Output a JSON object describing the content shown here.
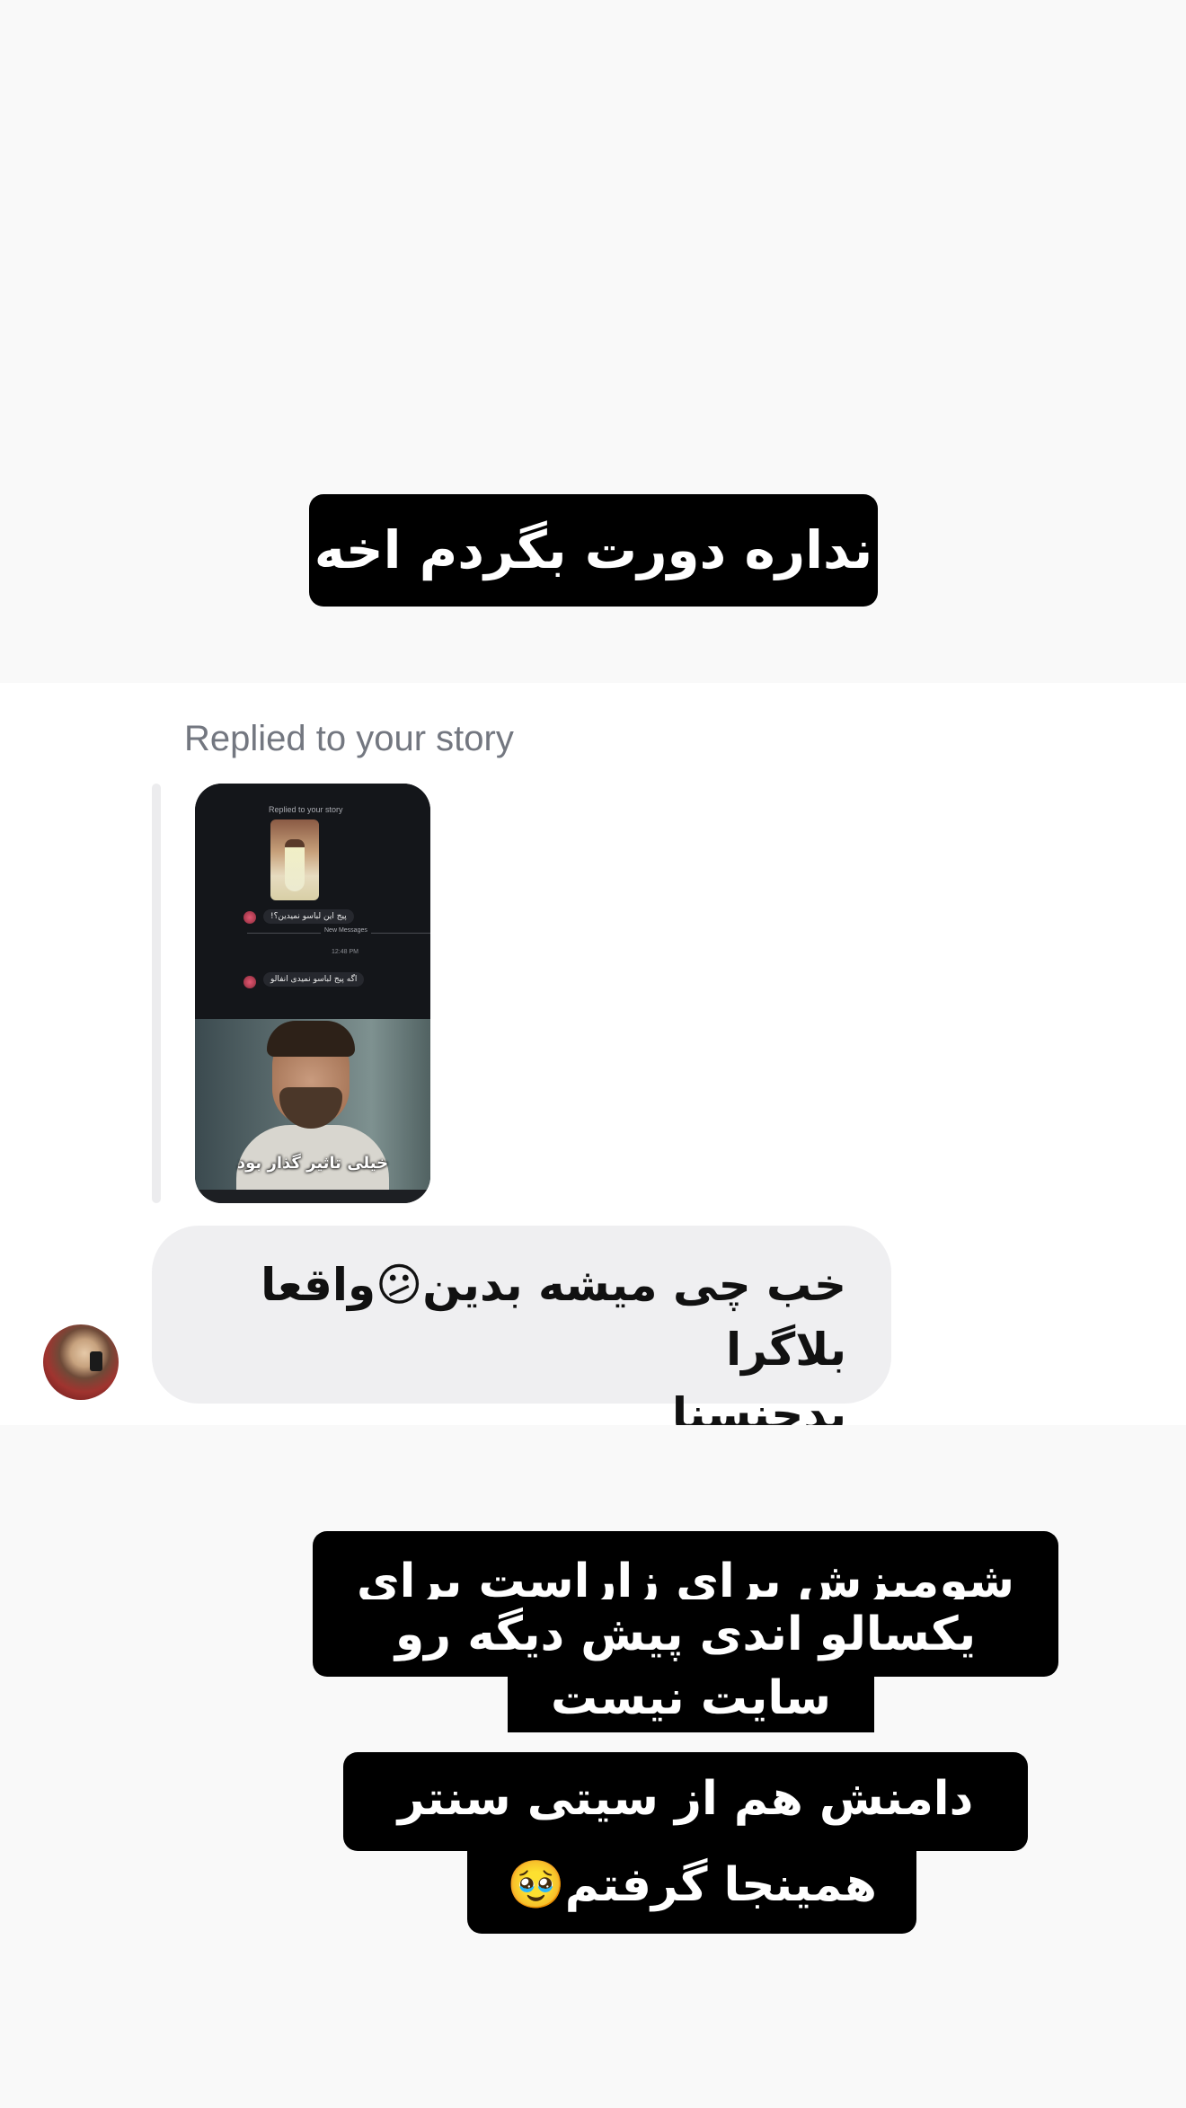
{
  "top_caption": {
    "text": "نداره دورت بگردم اخه"
  },
  "reply": {
    "label": "Replied to your story",
    "story_preview": {
      "header": "Replied to your story",
      "message_1": "پیج این لباسو نمیدین؟!",
      "divider_label": "New Messages",
      "time": "12:48 PM",
      "message_2": "اگه پیج لباسو نمیدی انفالو",
      "subtitle": "خیلی تاثیر گذار بود"
    }
  },
  "message": {
    "line_1": "خب چی میشه بدین😕واقعا بلاگرا",
    "line_2": "بدجنسنا"
  },
  "sender": {
    "avatar": "avatar"
  },
  "bottom_caption": {
    "lines": [
      "شومیزش برای زاراست برای",
      "یکسالو اندی پیش دیگه رو",
      "سایت نیست",
      "دامنش هم از سیتی سنتر",
      "همینجا گرفتم🥹"
    ]
  },
  "colors": {
    "page_background": "#f9f9f9",
    "chat_background": "#ffffff",
    "bubble_background": "#efeff1",
    "caption_background": "#000000",
    "label_gray": "#737780"
  }
}
